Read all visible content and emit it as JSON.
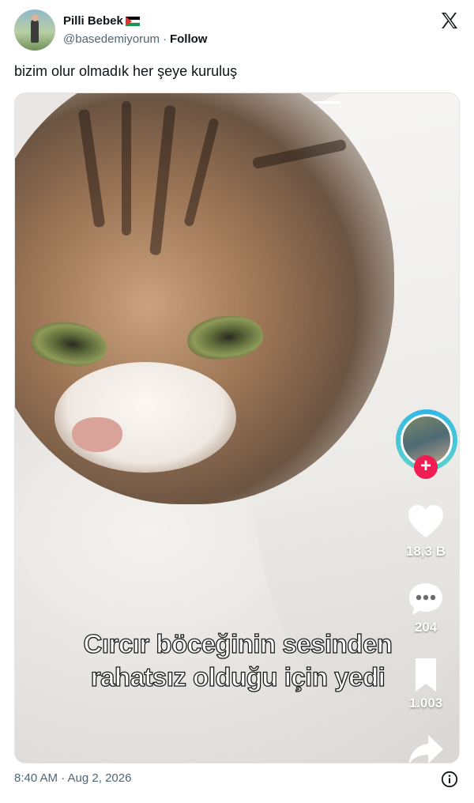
{
  "author": {
    "display_name": "Pilli Bebek",
    "handle": "@basedemiyorum",
    "separator": "·",
    "follow_label": "Follow"
  },
  "tweet": {
    "text": "bizim olur olmadık her şeye kuruluş"
  },
  "video": {
    "caption_line1": "Cırcır böceğinin sesinden",
    "caption_line2": "rahatsız olduğu için yedi",
    "likes": "18,3 B",
    "comments": "204",
    "saves": "1.003"
  },
  "footer": {
    "timestamp": "8:40 AM · Aug 2, 2026"
  },
  "icons": {
    "brand": "x-logo-icon",
    "flag": "palestine-flag-icon",
    "like": "heart-icon",
    "comment": "comment-bubble-icon",
    "save": "bookmark-icon",
    "share": "share-arrow-icon",
    "info": "info-icon"
  },
  "colors": {
    "follow_plus": "#ee1d52",
    "profile_ring": "#2fb6e8",
    "secondary_text": "#536471"
  }
}
